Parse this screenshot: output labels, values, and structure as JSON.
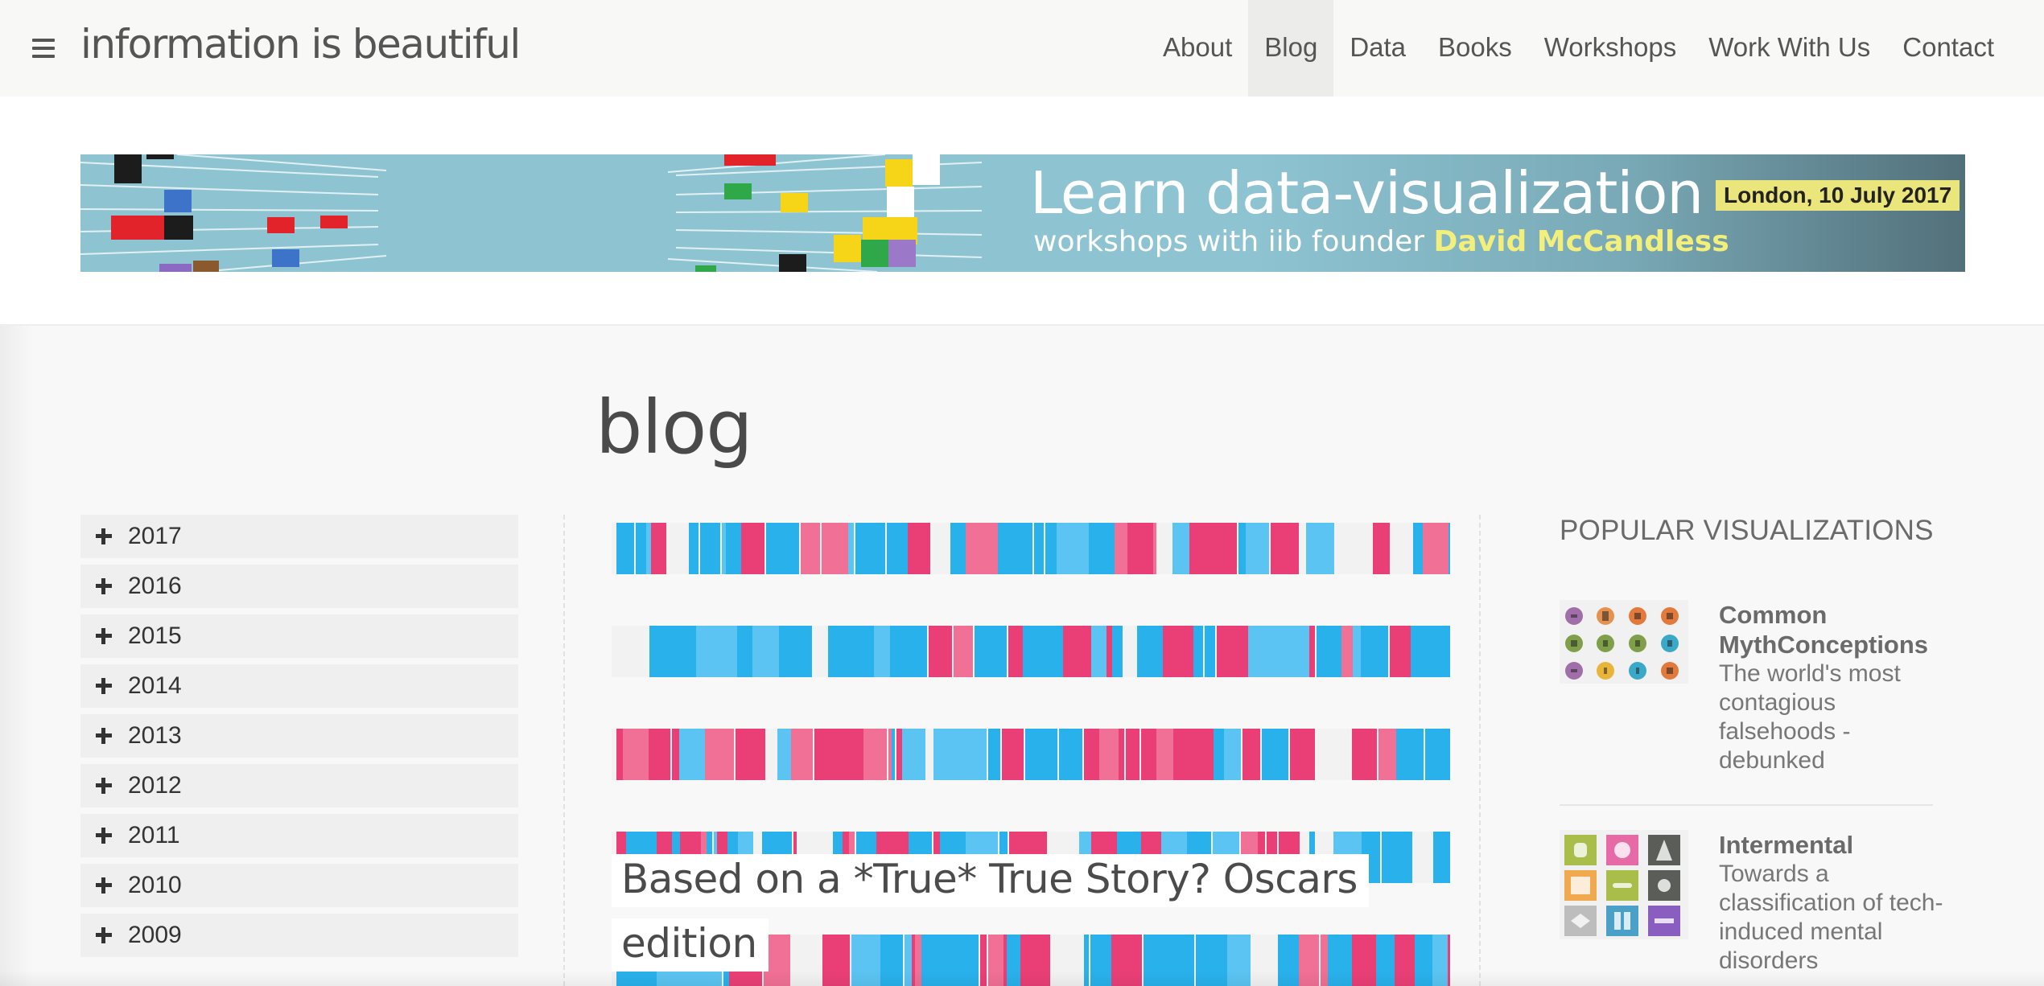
{
  "header": {
    "site_title": "information is beautiful",
    "menu_icon": "hamburger-menu-icon",
    "nav": [
      {
        "label": "About"
      },
      {
        "label": "Blog",
        "active": true
      },
      {
        "label": "Data"
      },
      {
        "label": "Books"
      },
      {
        "label": "Workshops"
      },
      {
        "label": "Work With Us"
      },
      {
        "label": "Contact"
      }
    ]
  },
  "banner": {
    "line1": "Learn data-visualization",
    "line2_prefix": "workshops with iib founder ",
    "line2_highlight": "David McCandless",
    "date_badge": "London, 10 July 2017",
    "colors": {
      "background": "#8ec4d2",
      "highlight": "#f2ef7c",
      "badge": "#ebe67c"
    }
  },
  "page": {
    "title": "blog"
  },
  "archive": {
    "expand_icon": "plus-icon",
    "years": [
      "2017",
      "2016",
      "2015",
      "2014",
      "2013",
      "2012",
      "2011",
      "2010",
      "2009"
    ]
  },
  "featured_post": {
    "title": "Based on a *True* True Story? Oscars edition",
    "image": "barcode-strip-visualization",
    "colors": {
      "pink": "#ea3f76",
      "light_pink": "#f17095",
      "blue": "#29b1ec",
      "light_blue": "#5bc4f2",
      "gap": "#f2f2f2"
    }
  },
  "popular": {
    "heading": "POPULAR VISUALIZATIONS",
    "items": [
      {
        "title": "Common MythConceptions",
        "description": "The world's most contagious falsehoods - debunked",
        "thumbnail": "myth-icons-grid"
      },
      {
        "title": "Intermental",
        "description": "Towards a classification of tech-induced mental disorders",
        "thumbnail": "intermental-icons-grid"
      }
    ]
  }
}
